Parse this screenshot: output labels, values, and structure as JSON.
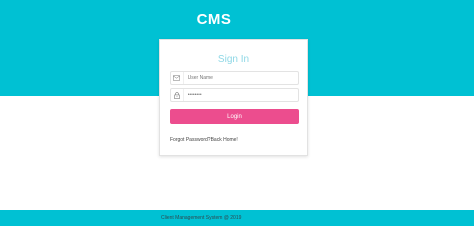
{
  "header": {
    "brand": "CMS"
  },
  "login": {
    "title": "Sign In",
    "username_placeholder": "User Name",
    "password_placeholder": "••••••••",
    "login_label": "Login",
    "forgot_label": "Forgot Password?",
    "back_label": "Back Home!"
  },
  "footer": {
    "text": "Client Management System @ 2019"
  },
  "colors": {
    "primary": "#00c1d3",
    "accent": "#ec4d8e",
    "title": "#8fd8e6"
  },
  "icons": {
    "username": "envelope-icon",
    "password": "lock-icon"
  }
}
